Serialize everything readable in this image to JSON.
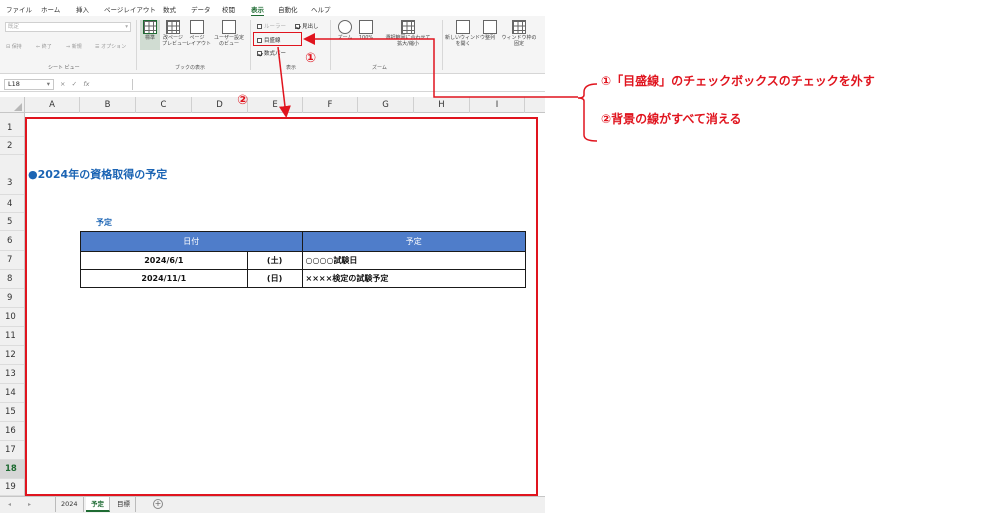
{
  "menu": {
    "items": [
      "ファイル",
      "ホーム",
      "挿入",
      "ページレイアウト",
      "数式",
      "データ",
      "校閲",
      "表示",
      "自動化",
      "ヘルプ"
    ],
    "active": "表示"
  },
  "ribbon": {
    "sheet_view": {
      "dropdown_value": "既定",
      "keep": "保持",
      "exit": "終了",
      "new": "新規",
      "options": "オプション",
      "label": "シート ビュー"
    },
    "workbook_view": {
      "normal": "標準",
      "page_break": "改ページ\nプレビュー",
      "page_layout": "ページ\nレイアウト",
      "custom": "ユーザー設定\nのビュー",
      "label": "ブックの表示"
    },
    "show": {
      "ruler": "ルーラー",
      "headings": "見出し",
      "gridlines": "目盛線",
      "formula_bar": "数式バー",
      "label": "表示"
    },
    "zoom": {
      "zoom": "ズーム",
      "hundred": "100%",
      "fit_selection": "選択範囲に合わせて\n拡大/縮小",
      "label": "ズーム"
    },
    "window": {
      "new_window": "新しいウィンドウ\nを開く",
      "arrange": "整列",
      "freeze": "ウィンドウ枠の\n固定"
    }
  },
  "formula_bar": {
    "name_box": "L18",
    "cancel": "×",
    "enter": "✓",
    "fx": "fx"
  },
  "columns": [
    "A",
    "B",
    "C",
    "D",
    "E",
    "F",
    "G",
    "H",
    "I"
  ],
  "rows": [
    "1",
    "2",
    "3",
    "4",
    "5",
    "6",
    "7",
    "8",
    "9",
    "10",
    "11",
    "12",
    "13",
    "14",
    "15",
    "16",
    "17",
    "18",
    "19"
  ],
  "active_row": "18",
  "sheet": {
    "heading": "●2024年の資格取得の予定",
    "subheading": "予定",
    "table": {
      "headers": [
        "日付",
        "予定"
      ],
      "rows": [
        {
          "date": "2024/6/1",
          "day": "(土)",
          "plan": "○○○○試験日"
        },
        {
          "date": "2024/11/1",
          "day": "(日)",
          "plan": "××××検定の試験予定"
        }
      ]
    }
  },
  "tabs": {
    "items": [
      "2024",
      "予定",
      "目標"
    ],
    "active": "予定",
    "add": "+"
  },
  "annotations": {
    "marker1": "①",
    "marker2": "②",
    "step1": "①「目盛線」のチェックボックスのチェックを外す",
    "step2": "②背景の線がすべて消える"
  },
  "colors": {
    "accent_red": "#e0141e",
    "heading_blue": "#1b64b4",
    "table_header_blue": "#4f7dca",
    "excel_green": "#1e6b32"
  }
}
